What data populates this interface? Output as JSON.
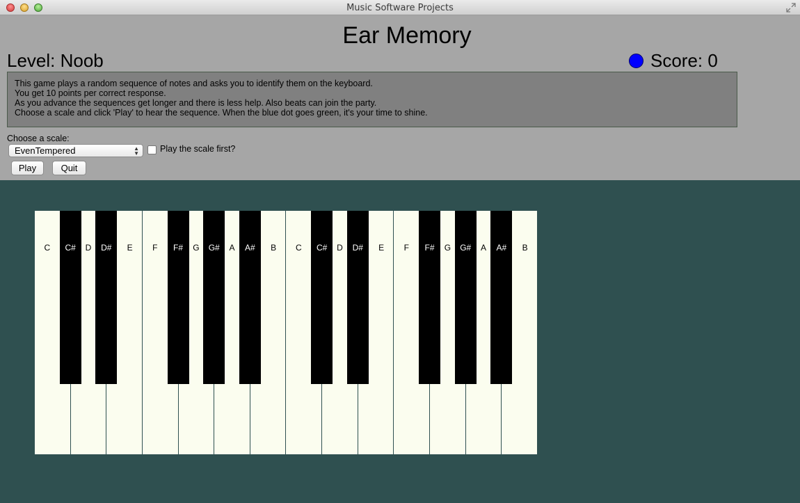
{
  "window": {
    "title": "Music Software Projects"
  },
  "app": {
    "title": "Ear Memory"
  },
  "level": {
    "text": "Level: Noob"
  },
  "score": {
    "text": "Score: 0",
    "status_dot_color": "#0000ff"
  },
  "instructions": [
    "This game plays a random sequence of notes and asks you to identify them on the keyboard.",
    "You get 10 points per correct response.",
    "As you advance the sequences get longer and there is less help. Also beats can join the party.",
    "Choose a scale and click 'Play' to hear the sequence. When the blue dot goes green, it's your time to shine."
  ],
  "scale": {
    "label": "Choose a scale:",
    "selected": "EvenTempered",
    "play_first_label": "Play the scale first?",
    "play_first_checked": false
  },
  "buttons": {
    "play": "Play",
    "quit": "Quit"
  },
  "keyboard": {
    "white_keys": [
      "C",
      "D",
      "E",
      "F",
      "G",
      "A",
      "B",
      "C",
      "D",
      "E",
      "F",
      "G",
      "A",
      "B"
    ],
    "black_keys": [
      "C#",
      "D#",
      "F#",
      "G#",
      "A#",
      "C#",
      "D#",
      "F#",
      "G#",
      "A#"
    ]
  },
  "colors": {
    "background": "#2f5050",
    "panel": "#a6a6a6",
    "key_white": "#fbfdef",
    "key_black": "#000000"
  }
}
